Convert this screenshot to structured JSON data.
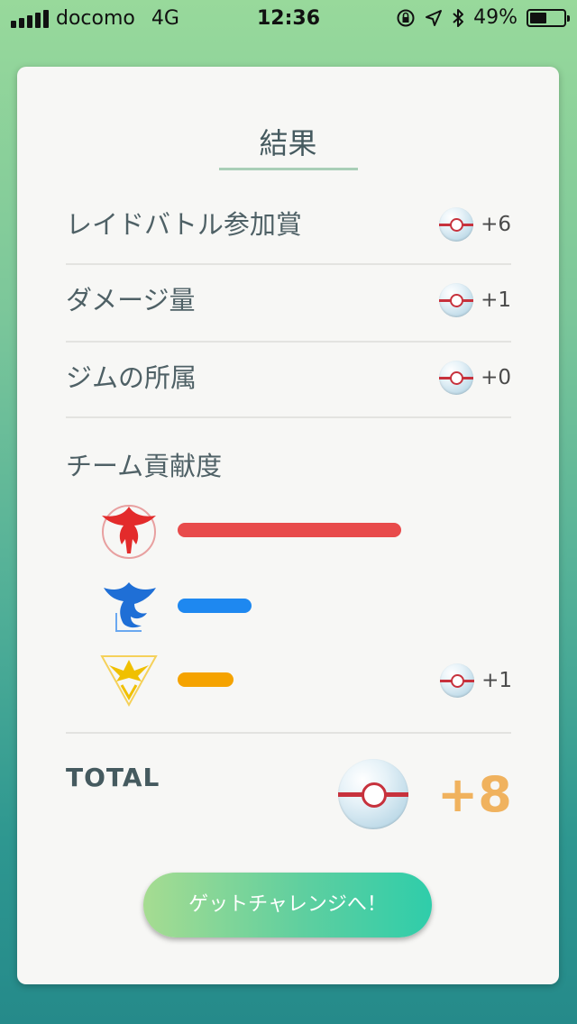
{
  "status_bar": {
    "carrier": "docomo",
    "network": "4G",
    "time": "12:36",
    "battery_percent": "49%",
    "battery_level": 0.49
  },
  "result": {
    "title": "結果",
    "rows": [
      {
        "label": "レイドバトル参加賞",
        "amount": "+6"
      },
      {
        "label": "ダメージ量",
        "amount": "+1"
      },
      {
        "label": "ジムの所属",
        "amount": "+0"
      }
    ],
    "team_section": {
      "title": "チーム貢献度",
      "teams": [
        {
          "name": "valor",
          "color": "#e84b4b",
          "contribution": 1.0
        },
        {
          "name": "mystic",
          "color": "#1e88f0",
          "contribution": 0.33
        },
        {
          "name": "instinct",
          "color": "#f5a300",
          "contribution": 0.25
        }
      ],
      "bonus_amount": "+1"
    },
    "total": {
      "label": "TOTAL",
      "amount": "+8"
    },
    "cta_label": "ゲットチャレンジへ！"
  },
  "colors": {
    "amount_total": "#f0b25e",
    "text": "#4f6166",
    "ball_band": "#c7323d"
  }
}
